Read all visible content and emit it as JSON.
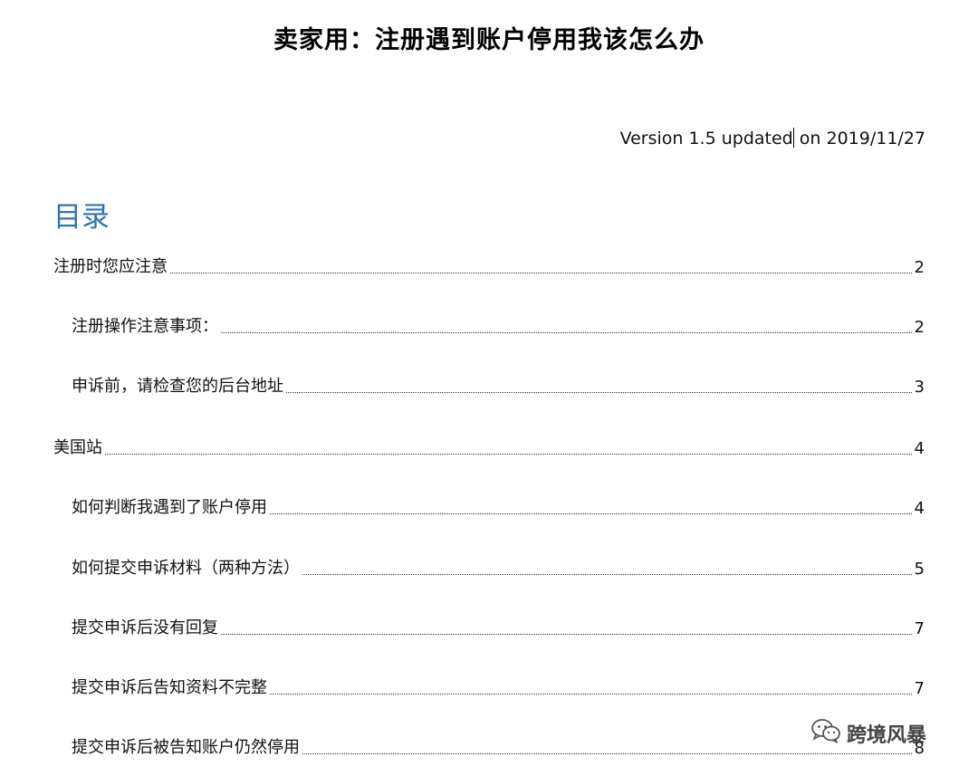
{
  "document": {
    "title": "卖家用：注册遇到账户停用我该怎么办",
    "version_before_caret": "Version 1.5 updated",
    "version_after_caret": " on 2019/11/27"
  },
  "toc": {
    "heading": "目录",
    "entries": [
      {
        "text": "注册时您应注意",
        "page": "2",
        "level": 1
      },
      {
        "text": "注册操作注意事项：",
        "page": "2",
        "level": 2
      },
      {
        "text": "申诉前，请检查您的后台地址",
        "page": "3",
        "level": 2
      },
      {
        "text": "美国站",
        "page": "4",
        "level": 1
      },
      {
        "text": "如何判断我遇到了账户停用",
        "page": "4",
        "level": 2
      },
      {
        "text": "如何提交申诉材料（两种方法）",
        "page": "5",
        "level": 2
      },
      {
        "text": "提交申诉后没有回复",
        "page": "7",
        "level": 2
      },
      {
        "text": "提交申诉后告知资料不完整",
        "page": "7",
        "level": 2
      },
      {
        "text": "提交申诉后被告知账户仍然停用",
        "page": "8",
        "level": 2
      }
    ]
  },
  "watermark": {
    "label": "跨境风暴",
    "icon": "wechat-icon"
  },
  "colors": {
    "heading": "#2e74b5",
    "text": "#111111"
  }
}
